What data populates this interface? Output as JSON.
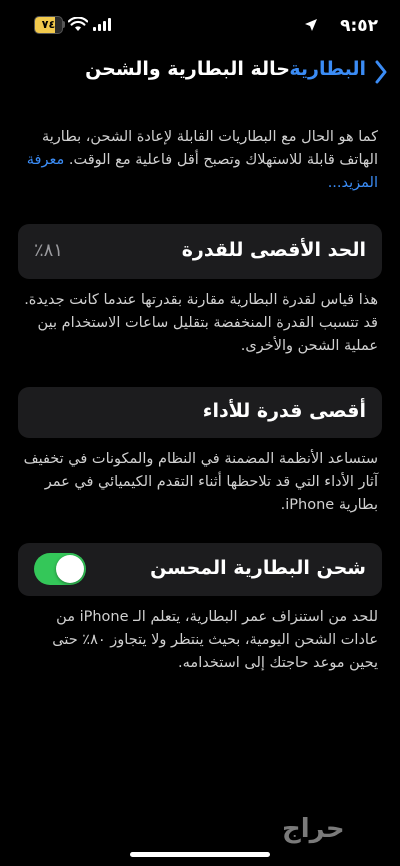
{
  "status_bar": {
    "time": "٩:٥٢",
    "battery_label": "٧٤",
    "battery_level": 0.74,
    "battery_color": "#f2c94c"
  },
  "nav": {
    "back_label": "البطارية",
    "title": "حالة البطارية والشحن",
    "accent_color": "#3b8cf5"
  },
  "intro": {
    "text": "كما هو الحال مع البطاريات القابلة لإعادة الشحن، بطارية الهاتف قابلة للاستهلاك وتصبح أقل فاعلية مع الوقت. ",
    "learn_more": "معرفة المزيد..."
  },
  "max_capacity": {
    "title": "الحد الأقصى للقدرة",
    "value": "٨١٪",
    "description": "هذا قياس لقدرة البطارية مقارنة بقدرتها عندما كانت جديدة. قد تتسبب القدرة المنخفضة بتقليل ساعات الاستخدام بين عملية الشحن والأخرى."
  },
  "peak_performance": {
    "title": "أقصى قدرة للأداء",
    "description": "ستساعد الأنظمة المضمنة في النظام والمكونات في تخفيف آثار الأداء التي قد تلاحظها أثناء التقدم الكيميائي في عمر بطارية iPhone."
  },
  "optimized_charging": {
    "title": "شحن البطارية المحسن",
    "enabled": true,
    "toggle_color": "#34c759",
    "description": "للحد من استنزاف عمر البطارية، يتعلم الـ iPhone من عادات الشحن اليومية، بحيث ينتظر ولا يتجاوز ٨٠٪ حتى يحين موعد حاجتك إلى استخدامه."
  },
  "watermark": {
    "text": "حراج"
  }
}
